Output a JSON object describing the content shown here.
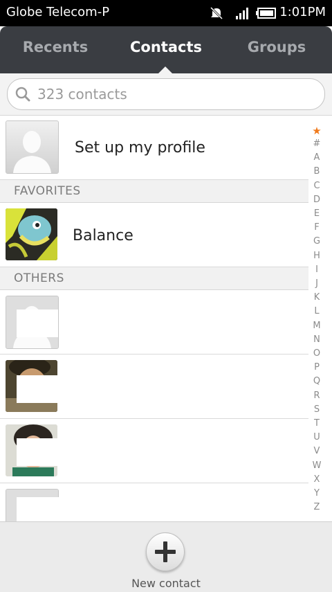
{
  "status_bar": {
    "carrier": "Globe Telecom-P",
    "time": "1:01PM",
    "icons": [
      "mute-icon",
      "signal-icon",
      "battery-icon"
    ]
  },
  "tabs": [
    {
      "label": "Recents",
      "active": false
    },
    {
      "label": "Contacts",
      "active": true
    },
    {
      "label": "Groups",
      "active": false
    }
  ],
  "search": {
    "placeholder": "323 contacts"
  },
  "profile": {
    "label": "Set up my profile"
  },
  "sections": {
    "favorites": "FAVORITES",
    "others": "OTHERS"
  },
  "favorites": [
    {
      "name": "Balance"
    }
  ],
  "index": {
    "star": "★",
    "letters": [
      "#",
      "A",
      "B",
      "C",
      "D",
      "E",
      "F",
      "G",
      "H",
      "I",
      "J",
      "K",
      "L",
      "M",
      "N",
      "O",
      "P",
      "Q",
      "R",
      "S",
      "T",
      "U",
      "V",
      "W",
      "X",
      "Y",
      "Z"
    ]
  },
  "bottom": {
    "new_contact": "New contact"
  },
  "colors": {
    "header_bg": "#3a3d42",
    "star": "#f07a1c"
  }
}
